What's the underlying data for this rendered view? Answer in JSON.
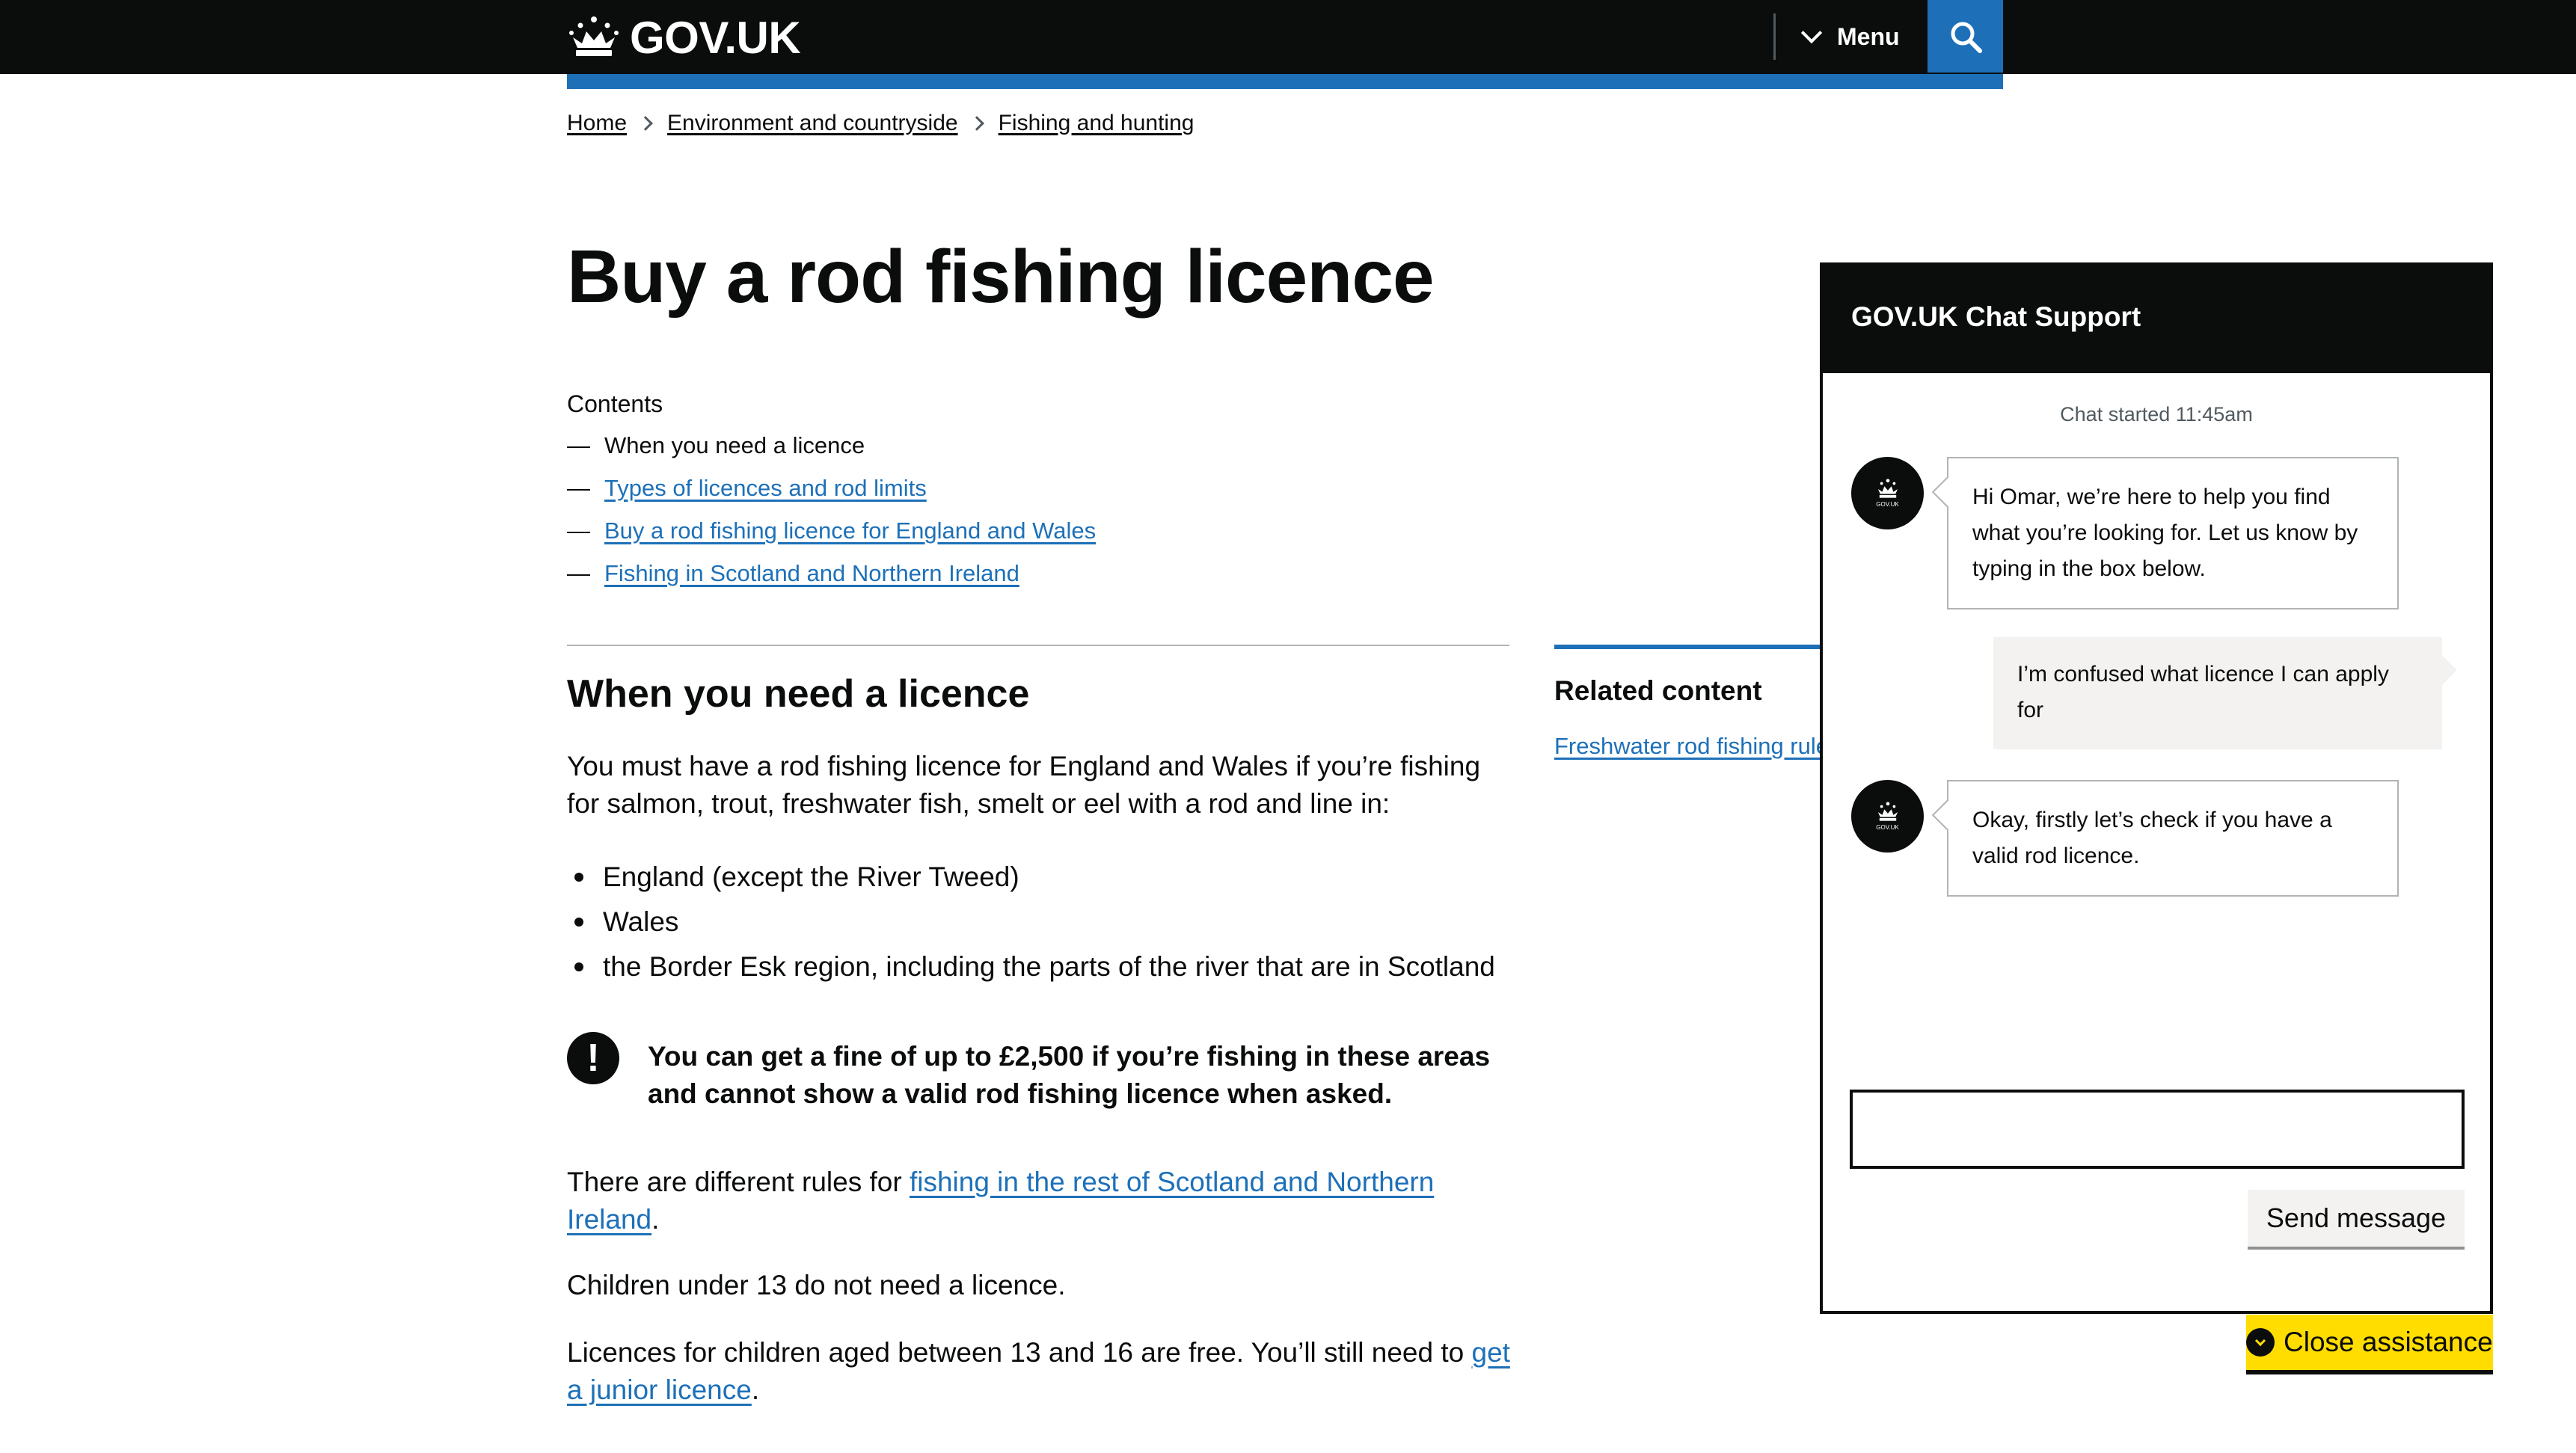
{
  "header": {
    "logo_text": "GOV.UK",
    "menu_label": "Menu"
  },
  "breadcrumb": [
    "Home",
    "Environment and countryside",
    "Fishing and hunting"
  ],
  "page": {
    "title": "Buy a rod fishing licence",
    "contents_heading": "Contents",
    "contents": [
      "When you need a licence",
      "Types of licences and rod limits",
      "Buy a rod fishing licence for England and Wales",
      "Fishing in Scotland and Northern Ireland"
    ],
    "section_heading": "When you need a licence",
    "intro": "You must have a rod fishing licence for England and Wales if you’re fishing for salmon, trout, freshwater fish, smelt or eel with a rod and line in:",
    "bullets": [
      "England (except the River Tweed)",
      "Wales",
      "the Border Esk region, including the parts of the river that are in Scotland"
    ],
    "warning_icon": "!",
    "warning": "You can get a fine of up to £2,500 if you’re fishing in these areas and cannot show a valid rod fishing licence when asked.",
    "rules_prefix": "There are different rules for ",
    "rules_link": "fishing in the rest of Scotland and Northern Ireland",
    "rules_suffix": ".",
    "children": "Children under 13 do not need a licence.",
    "junior_prefix": "Licences for children aged between 13 and 16 are free. You’ll still need to ",
    "junior_link": "get a junior licence",
    "junior_suffix": "."
  },
  "related": {
    "heading": "Related content",
    "link": "Freshwater rod fishing rules"
  },
  "chat": {
    "title": "GOV.UK Chat Support",
    "started": "Chat started 11:45am",
    "avatar_label": "GOV.UK",
    "messages": [
      {
        "from": "bot",
        "text": "Hi Omar, we’re here to help you find what you’re looking for. Let us know by typing in the box below."
      },
      {
        "from": "user",
        "text": "I’m confused what licence I can apply for"
      },
      {
        "from": "bot",
        "text": "Okay, firstly let’s check if you have a valid rod licence."
      }
    ],
    "input_value": "",
    "send_label": "Send message",
    "close_label": "Close assistance"
  },
  "colors": {
    "header_bg": "#0b0c0c",
    "link": "#1d70b8",
    "brand_blue": "#1d70b8",
    "focus_yellow": "#ffdd00",
    "grey_bg": "#f3f2f1"
  },
  "icons": [
    "crown-icon",
    "chevron-down-icon",
    "search-icon",
    "warning-icon",
    "chevron-circle-icon"
  ]
}
